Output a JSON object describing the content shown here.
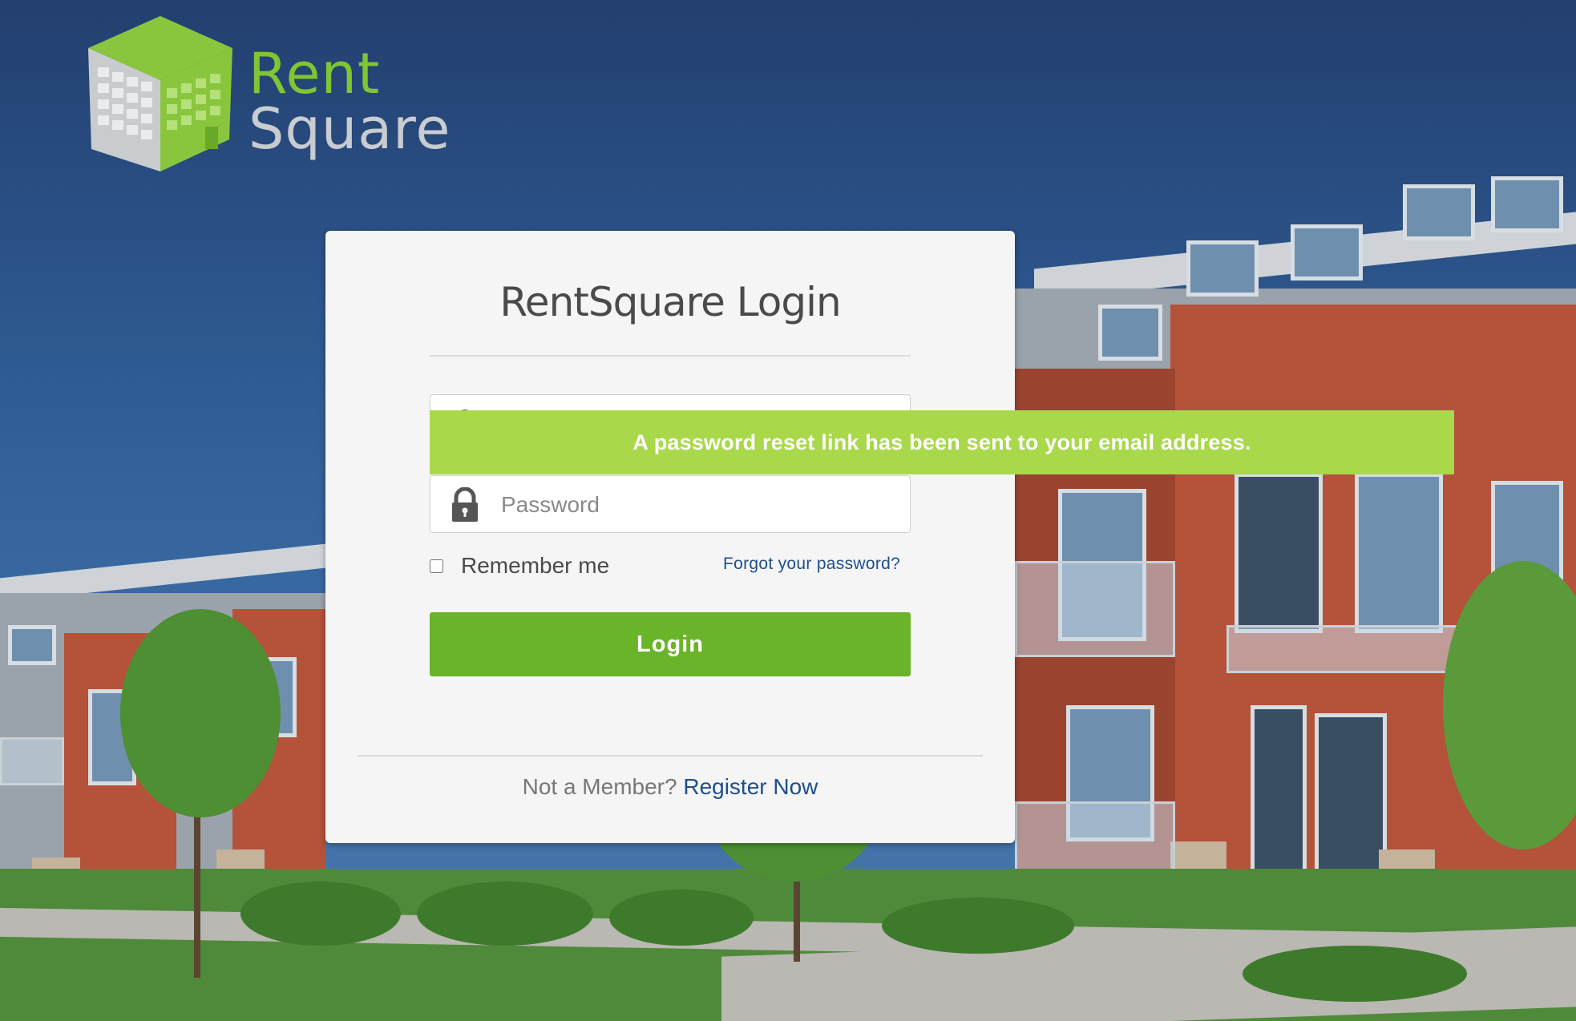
{
  "logo": {
    "line1": "Rent",
    "line2": "Square"
  },
  "login": {
    "title": "RentSquare Login",
    "email_placeholder": "",
    "password_placeholder": "Password",
    "remember_label": "Remember me",
    "forgot_link": "Forgot your password?",
    "login_button": "Login",
    "not_member_text": "Not a Member?",
    "register_link": "Register Now"
  },
  "alert": {
    "message": "A password reset link has been sent to your email address."
  },
  "icons": {
    "email": "user-icon",
    "password": "lock-icon"
  },
  "colors": {
    "brand_green": "#7fc534",
    "button_green": "#6ab42a",
    "alert_green": "#a9d84b",
    "link_blue": "#1f4f8a"
  }
}
